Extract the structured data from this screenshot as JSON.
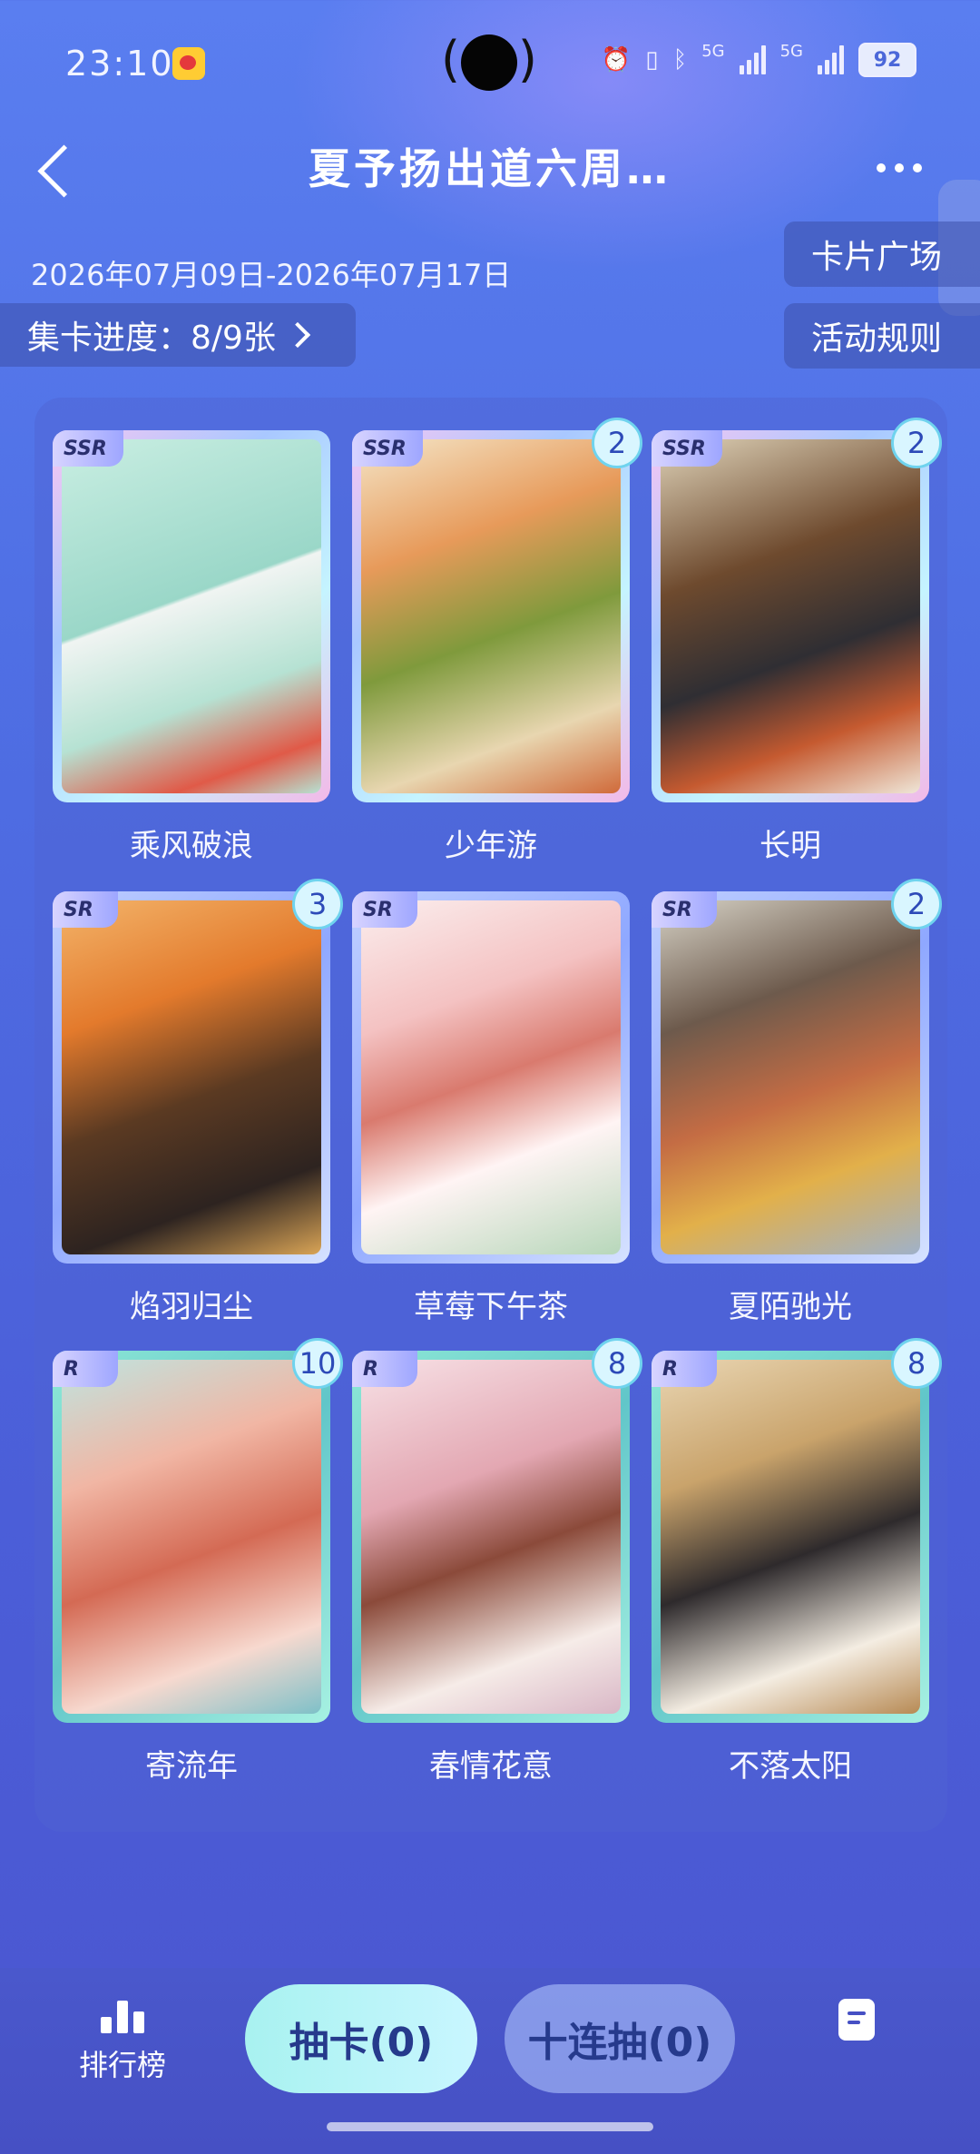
{
  "status_bar": {
    "time": "23:10",
    "net1": "5G",
    "net2": "5G",
    "battery": "92"
  },
  "header": {
    "title": "夏予扬出道六周…",
    "date_range": "2026年07月09日-2026年07月17日",
    "progress_label": "集卡进度：8/9张",
    "card_square_label": "卡片广场",
    "rules_label": "活动规则"
  },
  "cards": [
    {
      "name": "乘风破浪",
      "rarity": "SSR",
      "count": "",
      "frame": "ssr"
    },
    {
      "name": "少年游",
      "rarity": "SSR",
      "count": "2",
      "frame": "ssr"
    },
    {
      "name": "长明",
      "rarity": "SSR",
      "count": "2",
      "frame": "ssr"
    },
    {
      "name": "焰羽归尘",
      "rarity": "SR",
      "count": "3",
      "frame": "sr"
    },
    {
      "name": "草莓下午茶",
      "rarity": "SR",
      "count": "",
      "frame": "sr"
    },
    {
      "name": "夏陌驰光",
      "rarity": "SR",
      "count": "2",
      "frame": "sr"
    },
    {
      "name": "寄流年",
      "rarity": "R",
      "count": "10",
      "frame": "r"
    },
    {
      "name": "春情花意",
      "rarity": "R",
      "count": "8",
      "frame": "r"
    },
    {
      "name": "不落太阳",
      "rarity": "R",
      "count": "8",
      "frame": "r"
    }
  ],
  "bottom": {
    "rank_label": "排行榜",
    "draw_label": "抽卡(0)",
    "draw10_label": "十连抽(0)"
  },
  "icons": {
    "back": "chevron-left-icon",
    "more": "more-dots-icon",
    "rank": "bar-chart-icon",
    "notes": "notes-icon"
  }
}
